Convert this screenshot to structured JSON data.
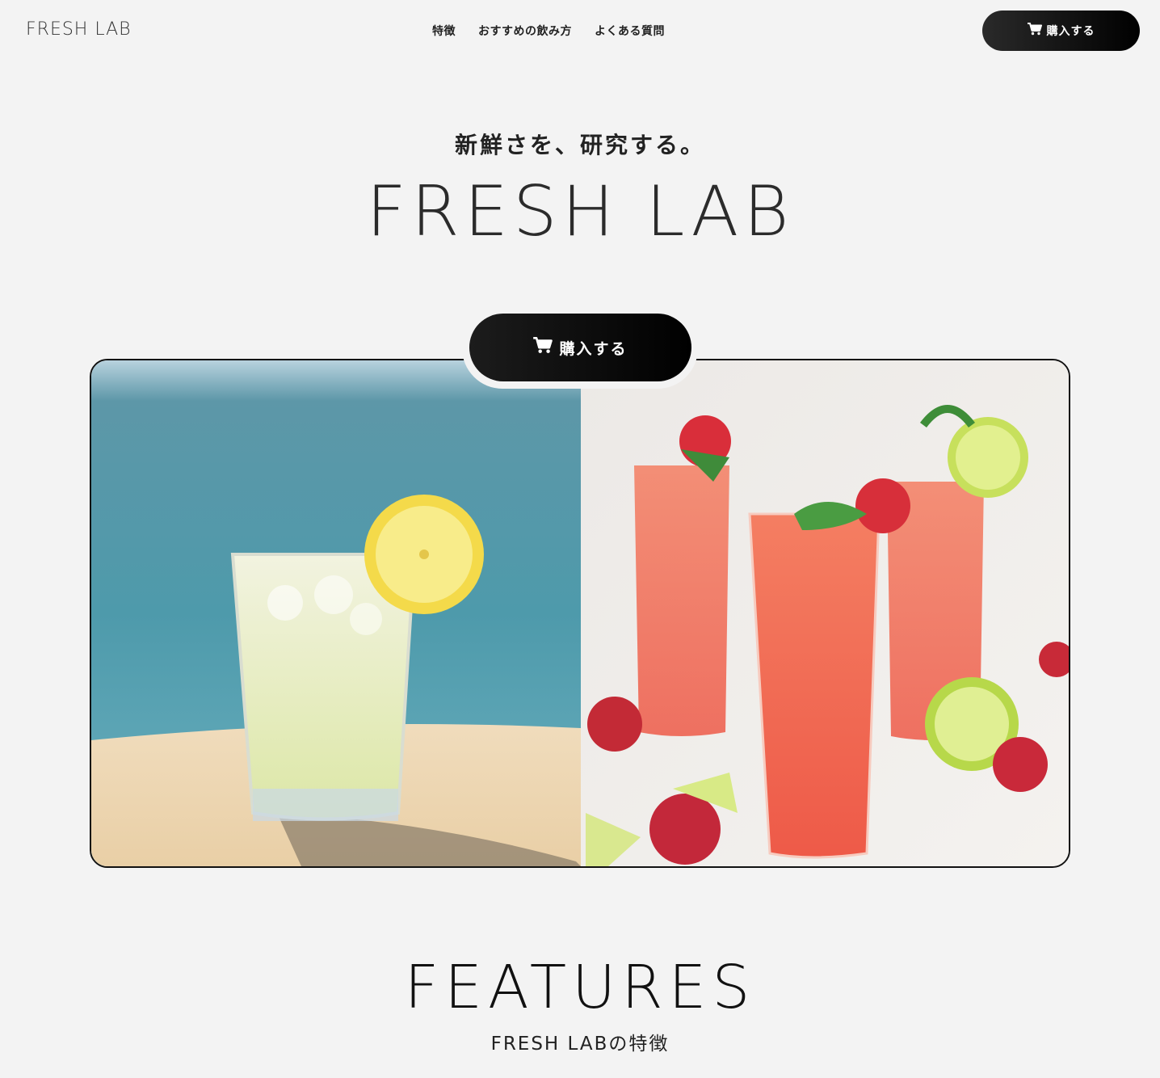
{
  "header": {
    "logo": "FRESH LAB",
    "nav": [
      {
        "label": "特徴"
      },
      {
        "label": "おすすめの飲み方"
      },
      {
        "label": "よくある質問"
      }
    ],
    "buy_label": "購入する"
  },
  "hero": {
    "tagline": "新鮮さを、研究する。",
    "title": "FRESH LAB",
    "buy_label": "購入する"
  },
  "features": {
    "title": "FEATURES",
    "subtitle": "FRESH LABの特徴"
  },
  "icons": {
    "cart": "shopping-cart-icon"
  },
  "colors": {
    "background": "#f3f3f3",
    "button": "#000000",
    "button_text": "#ffffff"
  }
}
